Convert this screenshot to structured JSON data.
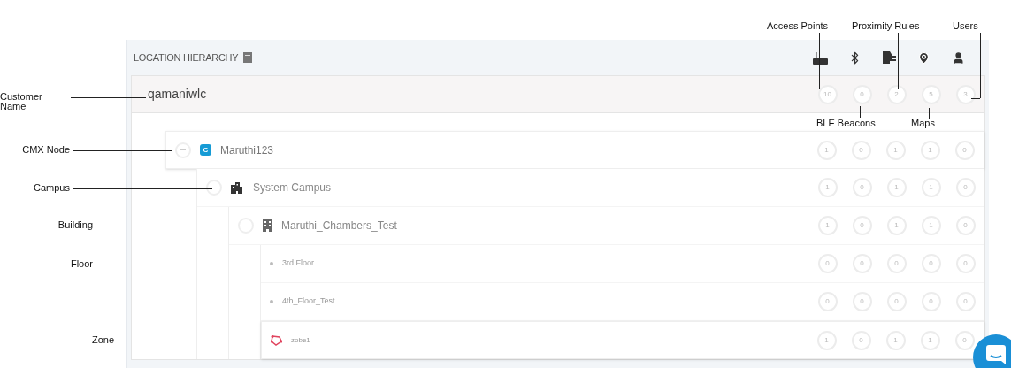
{
  "panel": {
    "title": "LOCATION HIERARCHY"
  },
  "customer": {
    "name": "qamaniwlc",
    "counts": [
      "10",
      "0",
      "2",
      "5",
      "3"
    ]
  },
  "tree": [
    {
      "kind": "cmx",
      "name": "Maruthi123",
      "badge": "C",
      "expanded": true,
      "counts": [
        "1",
        "0",
        "1",
        "1",
        "0"
      ],
      "children": [
        {
          "kind": "campus",
          "name": "System Campus",
          "expanded": true,
          "counts": [
            "1",
            "0",
            "1",
            "1",
            "0"
          ],
          "children": [
            {
              "kind": "building",
              "name": "Maruthi_Chambers_Test",
              "expanded": true,
              "counts": [
                "1",
                "0",
                "1",
                "1",
                "0"
              ],
              "children": [
                {
                  "kind": "floor",
                  "name": "3rd Floor",
                  "counts": [
                    "0",
                    "0",
                    "0",
                    "0",
                    "0"
                  ]
                },
                {
                  "kind": "floor",
                  "name": "4th_Floor_Test",
                  "counts": [
                    "0",
                    "0",
                    "0",
                    "0",
                    "0"
                  ]
                },
                {
                  "kind": "zone",
                  "name": "zobe1",
                  "counts": [
                    "1",
                    "0",
                    "1",
                    "1",
                    "0"
                  ]
                }
              ]
            }
          ]
        }
      ]
    }
  ],
  "annotations": {
    "left": [
      {
        "kind": "customer",
        "label": "Customer Name"
      },
      {
        "kind": "cmx",
        "label": "CMX Node"
      },
      {
        "kind": "campus",
        "label": "Campus"
      },
      {
        "kind": "building",
        "label": "Building"
      },
      {
        "kind": "floor",
        "label": "Floor"
      },
      {
        "kind": "zone",
        "label": "Zone"
      }
    ],
    "top": [
      "Access Points",
      "Proximity Rules",
      "Users"
    ],
    "bottom": [
      "BLE Beacons",
      "Maps"
    ]
  }
}
